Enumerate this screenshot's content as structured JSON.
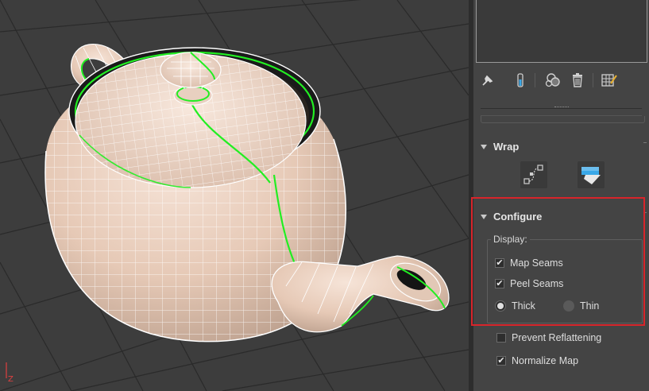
{
  "viewport": {
    "axis_label": "Z"
  },
  "panel": {
    "toolbar": {
      "icons": [
        "pin-stack-icon",
        "show-end-result-icon",
        "make-unique-icon",
        "remove-modifier-icon",
        "configure-modifier-sets-icon"
      ]
    },
    "wrap": {
      "title": "Wrap",
      "buttons": [
        "spline-mapping-icon",
        "peel-icon"
      ]
    },
    "configure": {
      "title": "Configure",
      "display_label": "Display:",
      "map_seams": {
        "label": "Map Seams",
        "checked": true
      },
      "peel_seams": {
        "label": "Peel Seams",
        "checked": true
      },
      "thickness": {
        "options": [
          "Thick",
          "Thin"
        ],
        "selected": "Thick"
      },
      "prevent_reflattening": {
        "label": "Prevent Reflattening",
        "checked": false
      },
      "normalize_map": {
        "label": "Normalize Map",
        "checked": true
      }
    },
    "colors": {
      "highlight": "#d8252b",
      "seam": "#22ee22",
      "mesh": "#e8cbb8"
    }
  }
}
